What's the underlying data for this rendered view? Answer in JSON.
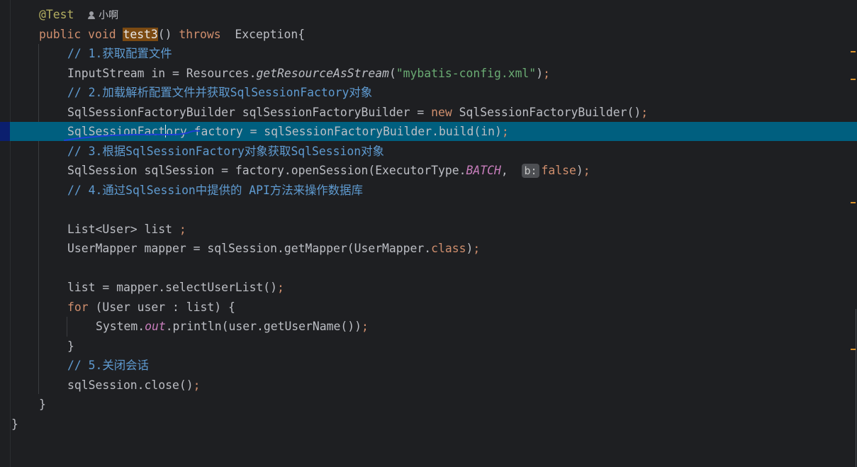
{
  "editor": {
    "annotation": "@Test",
    "author": "小啊",
    "method_signature": {
      "kw_public": "public",
      "kw_void": "void",
      "name": "test3",
      "parens": "()",
      "kw_throws": "throws",
      "exception": "Exception{"
    },
    "lines": {
      "c1": "// 1.获取配置文件",
      "l2_pre": "InputStream in = Resources.",
      "l2_method": "getResourceAsStream",
      "l2_open": "(",
      "l2_str": "\"mybatis-config.xml\"",
      "l2_close": ")",
      "l2_semi": ";",
      "c2": "// 2.加载解析配置文件并获取SqlSessionFactory对象",
      "l4_pre": "SqlSessionFactoryBuilder sqlSessionFactoryBuilder = ",
      "l4_new": "new",
      "l4_post": " SqlSessionFactoryBuilder()",
      "l4_semi": ";",
      "l5_a": "SqlSessionFact",
      "l5_b": "ory factory = sqlSessionFactoryBuilder.build(in)",
      "l5_semi": ";",
      "c3": "// 3.根据SqlSessionFactory对象获取SqlSession对象",
      "l7_pre": "SqlSession sqlSession = factory.openSession(ExecutorType.",
      "l7_static": "BATCH",
      "l7_comma": ", ",
      "l7_hint": "b:",
      "l7_false": "false",
      "l7_close": ")",
      "l7_semi": ";",
      "c4": "// 4.通过SqlSession中提供的 API方法来操作数据库",
      "l9_pre": "List<User> list ",
      "l9_semi": ";",
      "l10_pre": "UserMapper mapper = sqlSession.getMapper(UserMapper.",
      "l10_kw": "class",
      "l10_close": ")",
      "l10_semi": ";",
      "l11_pre": "list = mapper.selectUserList()",
      "l11_semi": ";",
      "l12_for": "for",
      "l12_post": " (User user : list) {",
      "l13_pre": "System.",
      "l13_out": "out",
      "l13_post": ".println(user.getUserName())",
      "l13_semi": ";",
      "l14": "}",
      "c5": "// 5.关闭会话",
      "l16_pre": "sqlSession.close()",
      "l16_semi": ";",
      "l17": "}",
      "l18": "}"
    }
  },
  "colors": {
    "background": "#1e1f22",
    "keyword": "#cf8e6d",
    "string": "#6aab73",
    "comment": "#5f9bd1",
    "static_field": "#c77dbb",
    "annotation": "#b3ae60",
    "current_line": "#005f7f"
  },
  "icons": {
    "author": "person-icon"
  }
}
